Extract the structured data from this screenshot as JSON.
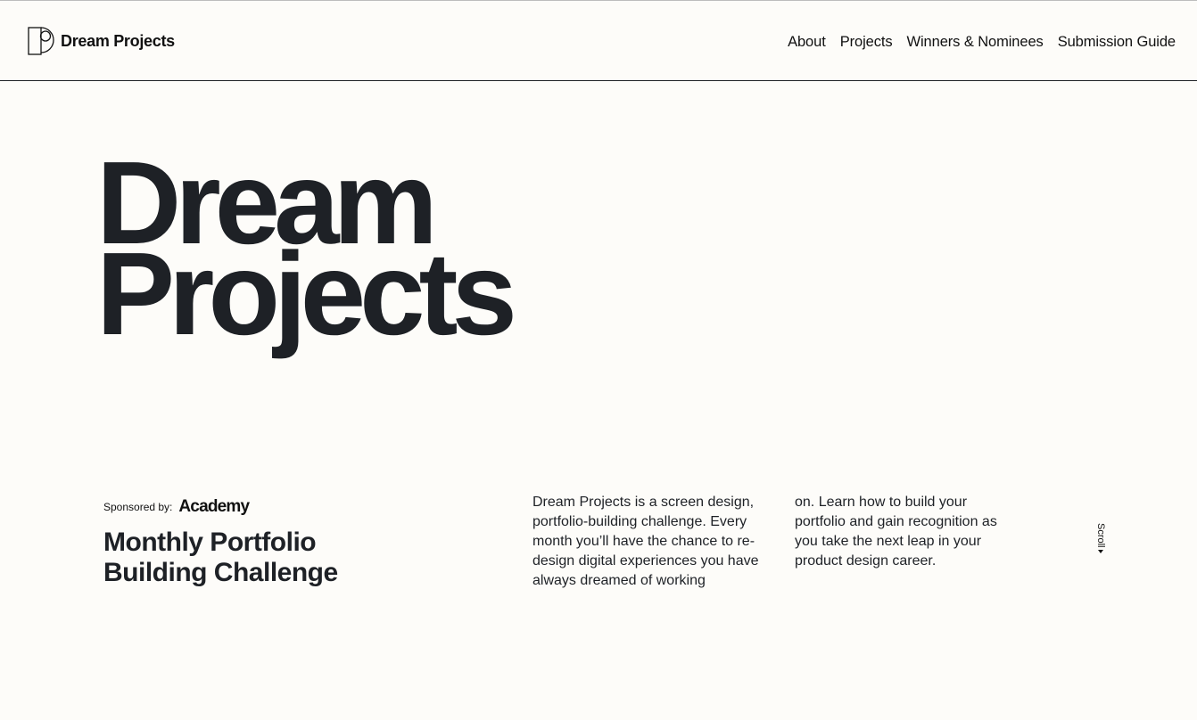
{
  "header": {
    "logo_text": "Dream Projects",
    "nav": [
      {
        "label": "About"
      },
      {
        "label": "Projects"
      },
      {
        "label": "Winners & Nominees"
      },
      {
        "label": "Submission Guide"
      }
    ]
  },
  "hero": {
    "title_line1": "Dream",
    "title_line2": "Projects"
  },
  "sponsor": {
    "label": "Sponsored by:",
    "name": "Academy"
  },
  "challenge": {
    "title": "Monthly Portfolio Building Challenge"
  },
  "description": {
    "column1": "Dream Projects is a screen design, portfolio-building challenge. Every month you’ll have the chance to re-design digital experiences you have always dreamed of working",
    "column2": "on. Learn how to build your portfolio and gain recognition as you take the next leap in your product design career."
  },
  "scroll": {
    "label": "Scroll",
    "icon": "caret-down-icon"
  },
  "colors": {
    "background": "#fdfcf9",
    "text": "#1e2126"
  }
}
